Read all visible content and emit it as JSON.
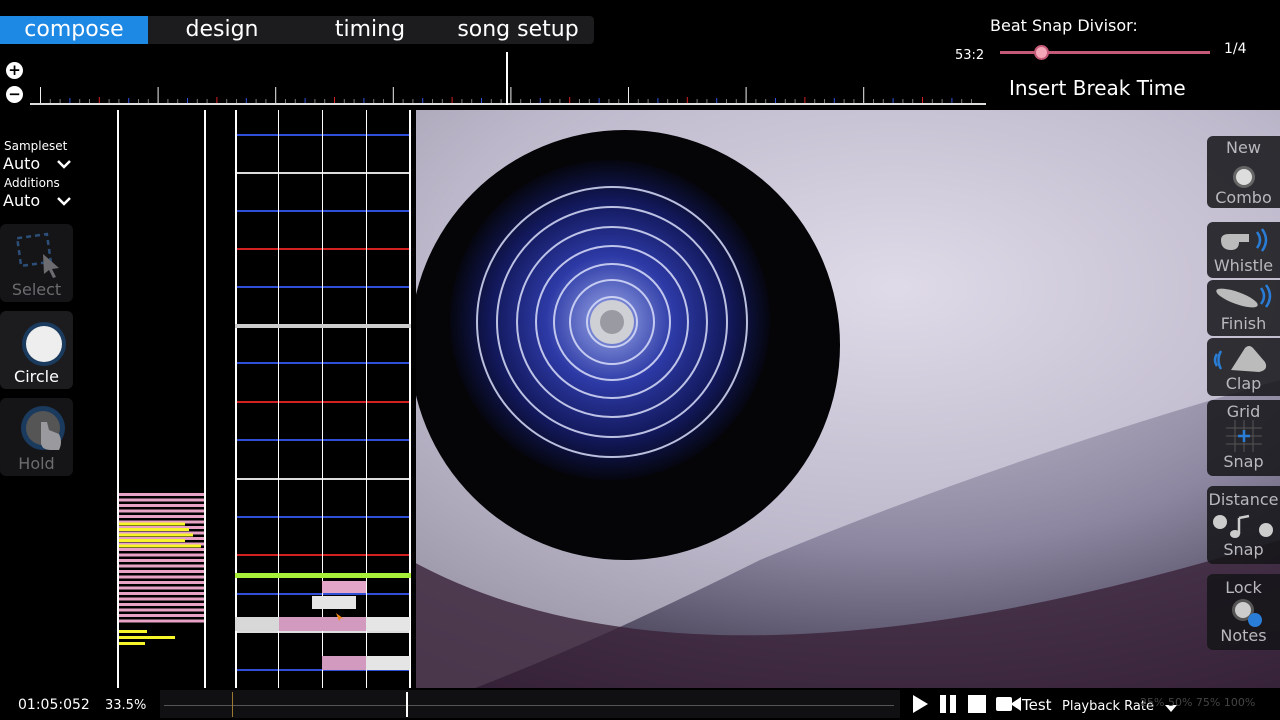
{
  "tabs": [
    {
      "label": "compose",
      "active": true
    },
    {
      "label": "design",
      "active": false
    },
    {
      "label": "timing",
      "active": false
    },
    {
      "label": "song setup",
      "active": false
    }
  ],
  "beat_snap": {
    "label": "Beat Snap Divisor:",
    "time": "53:2",
    "value": "1/4"
  },
  "insert_break": "Insert Break Time",
  "sampleset": {
    "label": "Sampleset",
    "value": "Auto"
  },
  "additions": {
    "label": "Additions",
    "value": "Auto"
  },
  "tools": {
    "select": "Select",
    "circle": "Circle",
    "hold": "Hold"
  },
  "right_buttons": {
    "new": "New",
    "combo": "Combo",
    "whistle": "Whistle",
    "finish": "Finish",
    "clap": "Clap",
    "grid": "Grid",
    "grid_snap": "Snap",
    "distance": "Distance",
    "distance_snap": "Snap",
    "lock": "Lock",
    "notes": "Notes"
  },
  "bottom": {
    "time": "01:05:052",
    "percent": "33.5%",
    "test": "Test",
    "playback_rate": "Playback Rate",
    "rate_options": "25% 50% 75% 100%"
  },
  "colors": {
    "accent": "#1e88e5",
    "red_tick": "#d32020",
    "blue_tick": "#2f4fd6",
    "green_line": "#a8ef3a",
    "pink": "#e8a2c6",
    "yellow": "#f5f52a"
  }
}
